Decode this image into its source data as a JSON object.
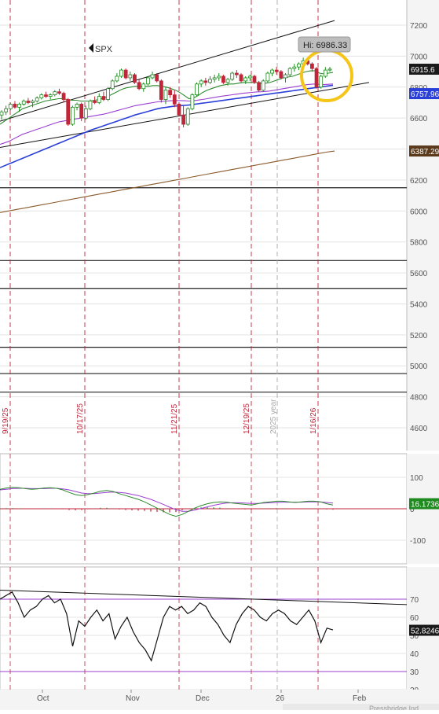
{
  "symbol": "SPX",
  "hi_label": "Hi: 6986.33",
  "colors": {
    "up": "#1f8a1f",
    "down": "#c0263a",
    "ma_fast": "#2e8b2e",
    "ma_mid": "#9b3fd1",
    "ma_long": "#2a3fd8",
    "ma_200": "#8b5a2b",
    "highlight": "#f5c518",
    "grid": "#e3e3e3",
    "vline": "#c0263a",
    "trend": "#111111"
  },
  "chart_data": [
    {
      "type": "candlestick",
      "title": "SPX",
      "ylim": [
        4500,
        7350
      ],
      "y_ticks": [
        "7200",
        "7000",
        "6800",
        "6600",
        "6400",
        "6200",
        "6000",
        "5800",
        "5600",
        "5400",
        "5200",
        "5000",
        "4800",
        "4600"
      ],
      "date_markers": [
        "9/19/25",
        "10/17/25",
        "11/21/25",
        "12/19/25",
        "1/16/26"
      ],
      "year_marker": "2025 year",
      "price_labels": {
        "last": "6915.6",
        "ma_mid": "6757.96",
        "ma_200": "6387.29"
      },
      "hi": 6986.33,
      "horizontal_levels": [
        6150,
        5680,
        5500,
        5120,
        4950,
        4830
      ],
      "candles": [
        [
          6620,
          6650,
          6590,
          6640
        ],
        [
          6640,
          6680,
          6620,
          6660
        ],
        [
          6660,
          6700,
          6650,
          6690
        ],
        [
          6690,
          6710,
          6660,
          6670
        ],
        [
          6670,
          6700,
          6640,
          6690
        ],
        [
          6690,
          6720,
          6680,
          6710
        ],
        [
          6710,
          6730,
          6690,
          6700
        ],
        [
          6700,
          6720,
          6670,
          6710
        ],
        [
          6710,
          6740,
          6700,
          6730
        ],
        [
          6730,
          6760,
          6720,
          6750
        ],
        [
          6750,
          6770,
          6730,
          6740
        ],
        [
          6740,
          6760,
          6720,
          6750
        ],
        [
          6750,
          6780,
          6740,
          6770
        ],
        [
          6770,
          6790,
          6750,
          6760
        ],
        [
          6760,
          6770,
          6700,
          6720
        ],
        [
          6720,
          6730,
          6550,
          6560
        ],
        [
          6560,
          6680,
          6550,
          6670
        ],
        [
          6670,
          6700,
          6650,
          6690
        ],
        [
          6690,
          6700,
          6580,
          6600
        ],
        [
          6600,
          6680,
          6590,
          6660
        ],
        [
          6660,
          6720,
          6650,
          6710
        ],
        [
          6710,
          6740,
          6690,
          6700
        ],
        [
          6700,
          6760,
          6690,
          6740
        ],
        [
          6740,
          6770,
          6710,
          6720
        ],
        [
          6720,
          6800,
          6710,
          6790
        ],
        [
          6790,
          6850,
          6780,
          6840
        ],
        [
          6840,
          6890,
          6830,
          6870
        ],
        [
          6870,
          6920,
          6860,
          6910
        ],
        [
          6910,
          6920,
          6850,
          6860
        ],
        [
          6860,
          6900,
          6840,
          6880
        ],
        [
          6880,
          6890,
          6820,
          6830
        ],
        [
          6830,
          6850,
          6780,
          6790
        ],
        [
          6790,
          6830,
          6770,
          6820
        ],
        [
          6820,
          6870,
          6810,
          6860
        ],
        [
          6860,
          6900,
          6850,
          6880
        ],
        [
          6880,
          6890,
          6830,
          6840
        ],
        [
          6840,
          6850,
          6700,
          6720
        ],
        [
          6720,
          6800,
          6690,
          6780
        ],
        [
          6780,
          6800,
          6730,
          6750
        ],
        [
          6750,
          6780,
          6670,
          6690
        ],
        [
          6690,
          6700,
          6610,
          6620
        ],
        [
          6620,
          6680,
          6540,
          6560
        ],
        [
          6560,
          6670,
          6550,
          6660
        ],
        [
          6660,
          6760,
          6650,
          6750
        ],
        [
          6750,
          6830,
          6740,
          6820
        ],
        [
          6820,
          6850,
          6800,
          6840
        ],
        [
          6840,
          6860,
          6810,
          6830
        ],
        [
          6830,
          6870,
          6820,
          6850
        ],
        [
          6850,
          6880,
          6830,
          6860
        ],
        [
          6860,
          6890,
          6840,
          6870
        ],
        [
          6870,
          6880,
          6820,
          6830
        ],
        [
          6830,
          6860,
          6810,
          6850
        ],
        [
          6850,
          6900,
          6840,
          6890
        ],
        [
          6890,
          6910,
          6860,
          6880
        ],
        [
          6880,
          6890,
          6830,
          6840
        ],
        [
          6840,
          6870,
          6820,
          6860
        ],
        [
          6860,
          6880,
          6840,
          6870
        ],
        [
          6870,
          6880,
          6820,
          6830
        ],
        [
          6830,
          6840,
          6770,
          6780
        ],
        [
          6780,
          6850,
          6770,
          6840
        ],
        [
          6840,
          6900,
          6830,
          6890
        ],
        [
          6890,
          6920,
          6870,
          6910
        ],
        [
          6910,
          6930,
          6880,
          6900
        ],
        [
          6900,
          6910,
          6850,
          6860
        ],
        [
          6860,
          6890,
          6830,
          6880
        ],
        [
          6880,
          6930,
          6870,
          6920
        ],
        [
          6920,
          6950,
          6900,
          6930
        ],
        [
          6930,
          6960,
          6910,
          6950
        ],
        [
          6950,
          6990,
          6930,
          6970
        ],
        [
          6970,
          6986,
          6940,
          6950
        ],
        [
          6950,
          6960,
          6900,
          6920
        ],
        [
          6920,
          6930,
          6790,
          6800
        ],
        [
          6800,
          6880,
          6790,
          6870
        ],
        [
          6870,
          6930,
          6860,
          6910
        ],
        [
          6910,
          6930,
          6900,
          6916
        ]
      ],
      "ma_fast": [
        6560,
        6580,
        6600,
        6620,
        6640,
        6660,
        6670,
        6680,
        6690,
        6700,
        6710,
        6715,
        6720,
        6725,
        6725,
        6720,
        6715,
        6715,
        6710,
        6710,
        6710,
        6715,
        6720,
        6730,
        6740,
        6755,
        6770,
        6785,
        6795,
        6800,
        6805,
        6805,
        6805,
        6805,
        6810,
        6810,
        6805,
        6800,
        6790,
        6780,
        6765,
        6745,
        6725,
        6730,
        6745,
        6765,
        6780,
        6790,
        6800,
        6810,
        6815,
        6820,
        6820,
        6825,
        6830,
        6830,
        6830,
        6830,
        6825,
        6825,
        6830,
        6840,
        6850,
        6860,
        6865,
        6870,
        6880,
        6890,
        6900,
        6905,
        6905,
        6890,
        6885,
        6890,
        6895
      ],
      "ma_mid": [
        6430,
        6440,
        6450,
        6465,
        6480,
        6495,
        6505,
        6515,
        6525,
        6535,
        6545,
        6555,
        6565,
        6575,
        6580,
        6585,
        6590,
        6595,
        6600,
        6605,
        6610,
        6615,
        6620,
        6625,
        6632,
        6640,
        6648,
        6656,
        6664,
        6672,
        6680,
        6685,
        6690,
        6695,
        6700,
        6705,
        6708,
        6710,
        6712,
        6713,
        6713,
        6712,
        6710,
        6712,
        6716,
        6720,
        6725,
        6730,
        6735,
        6740,
        6744,
        6748,
        6752,
        6756,
        6760,
        6763,
        6766,
        6769,
        6770,
        6772,
        6775,
        6780,
        6785,
        6790,
        6795,
        6800,
        6805,
        6810,
        6815,
        6818,
        6820,
        6818,
        6816,
        6818,
        6820
      ],
      "ma_long": [
        6280,
        6292,
        6304,
        6316,
        6328,
        6340,
        6352,
        6364,
        6376,
        6388,
        6400,
        6412,
        6424,
        6436,
        6448,
        6460,
        6472,
        6484,
        6496,
        6508,
        6520,
        6530,
        6540,
        6550,
        6560,
        6570,
        6580,
        6590,
        6600,
        6610,
        6620,
        6628,
        6636,
        6644,
        6652,
        6660,
        6666,
        6670,
        6674,
        6678,
        6680,
        6682,
        6684,
        6688,
        6692,
        6696,
        6700,
        6704,
        6708,
        6712,
        6716,
        6720,
        6724,
        6728,
        6732,
        6736,
        6740,
        6744,
        6748,
        6752,
        6756,
        6760,
        6764,
        6768,
        6772,
        6776,
        6780,
        6784,
        6788,
        6792,
        6796,
        6800,
        6804,
        6808,
        6812
      ],
      "ma_200": [
        5990,
        6000,
        6010,
        6020,
        6030,
        6040,
        6050,
        6060,
        6070,
        6080,
        6090,
        6100,
        6110,
        6120,
        6130,
        6140,
        6150,
        6160,
        6170,
        6180,
        6190,
        6200,
        6210,
        6220,
        6230,
        6240,
        6250,
        6260,
        6270,
        6280,
        6290,
        6300,
        6310,
        6320,
        6330,
        6340,
        6350,
        6360,
        6370,
        6380,
        6387
      ]
    },
    {
      "type": "line",
      "title": "MACD",
      "ylim": [
        -130,
        130
      ],
      "y_ticks": [
        "100",
        "0",
        "-100"
      ],
      "last_value": "16.1736",
      "macd": [
        62,
        66,
        68,
        67,
        64,
        62,
        63,
        66,
        67,
        65,
        60,
        52,
        45,
        42,
        45,
        50,
        56,
        58,
        55,
        48,
        42,
        36,
        30,
        22,
        12,
        2,
        -8,
        -18,
        -24,
        -18,
        -8,
        2,
        10,
        16,
        20,
        22,
        21,
        18,
        16,
        14,
        12,
        16,
        20,
        22,
        24,
        24,
        22,
        20,
        22,
        24,
        24,
        22,
        16,
        12
      ],
      "signal": [
        60,
        62,
        64,
        65,
        65,
        64,
        64,
        64,
        65,
        65,
        63,
        60,
        55,
        50,
        48,
        48,
        50,
        52,
        53,
        52,
        50,
        46,
        42,
        36,
        30,
        22,
        14,
        5,
        -3,
        -8,
        -8,
        -4,
        1,
        6,
        11,
        15,
        18,
        19,
        19,
        18,
        17,
        17,
        18,
        19,
        20,
        21,
        21,
        21,
        21,
        22,
        22,
        22,
        20,
        18
      ],
      "histogram": [
        2,
        4,
        4,
        2,
        -1,
        -2,
        -1,
        2,
        2,
        0,
        -3,
        -8,
        -10,
        -8,
        -3,
        2,
        6,
        6,
        2,
        -4,
        -8,
        -10,
        -12,
        -14,
        -18,
        -20,
        -22,
        -23,
        -21,
        -10,
        0,
        6,
        9,
        10,
        9,
        7,
        3,
        -1,
        -3,
        -4,
        -5,
        -1,
        2,
        3,
        4,
        3,
        1,
        -1,
        1,
        2,
        2,
        0,
        -4,
        -6
      ]
    },
    {
      "type": "line",
      "title": "RSI",
      "ylim": [
        20,
        80
      ],
      "y_ticks": [
        "70",
        "60",
        "50",
        "40",
        "30",
        "20"
      ],
      "last_value": "52.8246",
      "levels": [
        70,
        30
      ],
      "values": [
        70,
        72,
        74,
        68,
        60,
        64,
        66,
        70,
        72,
        68,
        70,
        62,
        44,
        58,
        55,
        60,
        64,
        58,
        62,
        48,
        55,
        60,
        52,
        46,
        42,
        36,
        48,
        60,
        66,
        64,
        66,
        62,
        64,
        68,
        66,
        60,
        56,
        50,
        46,
        56,
        62,
        66,
        64,
        60,
        58,
        62,
        64,
        62,
        58,
        56,
        60,
        64,
        58,
        46,
        54,
        53
      ],
      "trendline": [
        [
          0,
          75
        ],
        [
          1,
          65
        ]
      ]
    }
  ],
  "x_axis": {
    "labels": [
      "Oct",
      "Nov",
      "Dec",
      "26",
      "Feb"
    ]
  },
  "bottom_text": "Pressbridge Ind",
  "footer_icons": [
    "search-icon",
    "zoom-in-icon",
    "zoom-out-icon",
    "back-icon",
    "forward-icon"
  ]
}
